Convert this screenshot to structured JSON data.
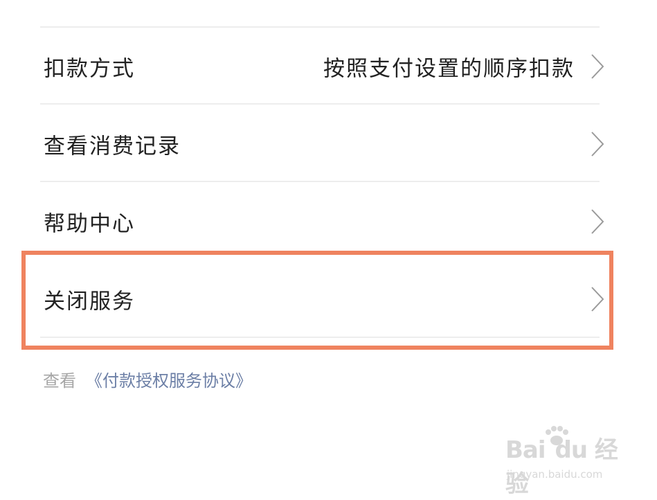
{
  "settings": {
    "rows": [
      {
        "label": "扣款方式",
        "value": "按照支付设置的顺序扣款"
      },
      {
        "label": "查看消费记录",
        "value": ""
      },
      {
        "label": "帮助中心",
        "value": ""
      },
      {
        "label": "关闭服务",
        "value": ""
      }
    ]
  },
  "footer": {
    "prefix": "查看",
    "link": "《付款授权服务协议》"
  },
  "highlight": {
    "color": "#ef835f",
    "target": "关闭服务"
  },
  "watermark": {
    "logo_text": "Bai du 经验",
    "url": "jingyan.baidu.com"
  }
}
